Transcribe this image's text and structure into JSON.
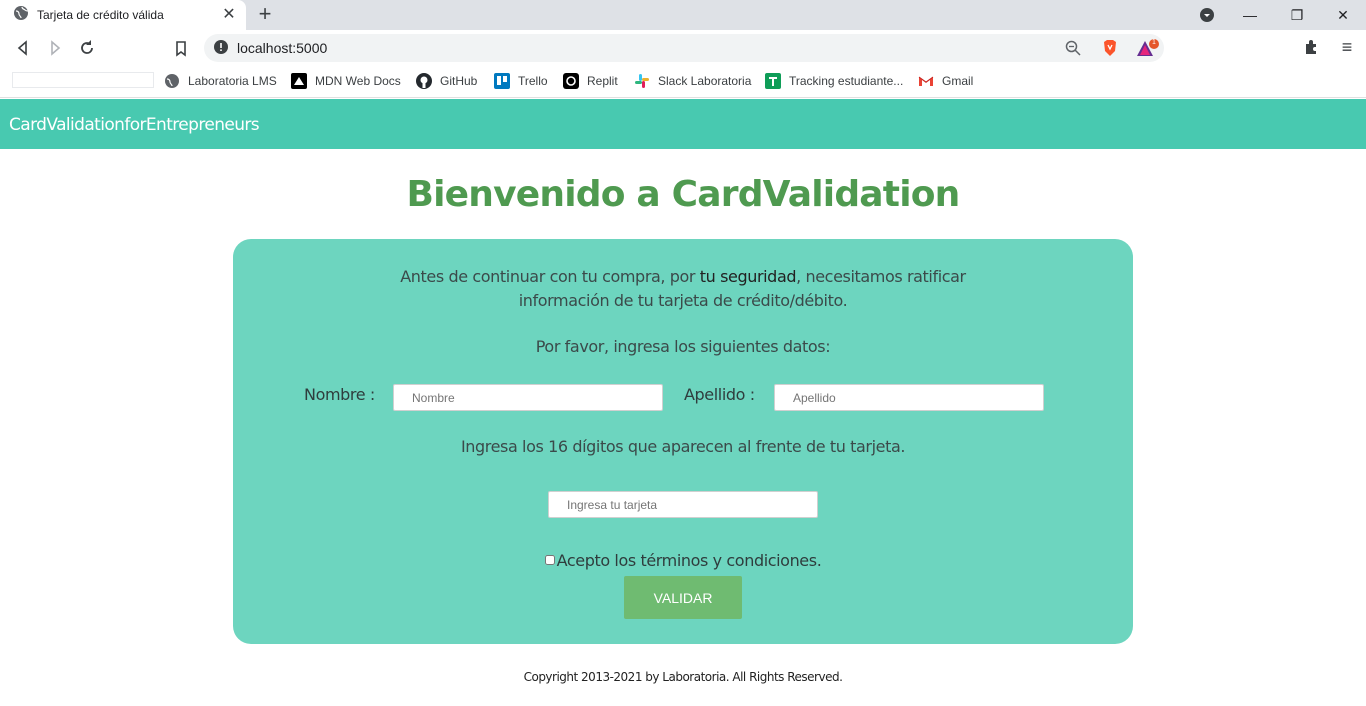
{
  "browser": {
    "tab_title": "Tarjeta de crédito válida",
    "url": "localhost:5000",
    "brave_badge": "1",
    "bookmarks": [
      {
        "label": "Laboratoria LMS",
        "icon": "globe-icon"
      },
      {
        "label": "MDN Web Docs",
        "icon": "mdn-icon"
      },
      {
        "label": "GitHub",
        "icon": "github-icon"
      },
      {
        "label": "Trello",
        "icon": "trello-icon"
      },
      {
        "label": "Replit",
        "icon": "replit-icon"
      },
      {
        "label": "Slack Laboratoria",
        "icon": "slack-icon"
      },
      {
        "label": "Tracking estudiante...",
        "icon": "sheets-icon"
      },
      {
        "label": "Gmail",
        "icon": "gmail-icon"
      }
    ]
  },
  "navbar": {
    "brand": "CardValidationforEntrepreneurs",
    "color": "#48c9b0"
  },
  "main": {
    "title": "Bienvenido a CardValidation",
    "intro_pre": "Antes de continuar con tu compra, por ",
    "intro_bold": "tu seguridad",
    "intro_post": ", necesitamos ratificar",
    "intro_line2": "información de tu tarjeta de crédito/débito.",
    "prompt": "Por favor, ingresa los siguientes datos:",
    "nombre_label": "Nombre :",
    "nombre_placeholder": "Nombre",
    "apellido_label": "Apellido :",
    "apellido_placeholder": "Apellido",
    "digits_text": "Ingresa los 16 dígitos que aparecen al frente de tu tarjeta.",
    "card_placeholder": "Ingresa tu tarjeta",
    "terms_label": "Acepto los términos y condiciones.",
    "validate_button": "VALIDAR"
  },
  "footer": {
    "text": "Copyright 2013-2021 by Laboratoria. All Rights Reserved."
  },
  "colors": {
    "card": "#6dd5bf",
    "title": "#4f9a50",
    "button": "#6fbb71"
  }
}
